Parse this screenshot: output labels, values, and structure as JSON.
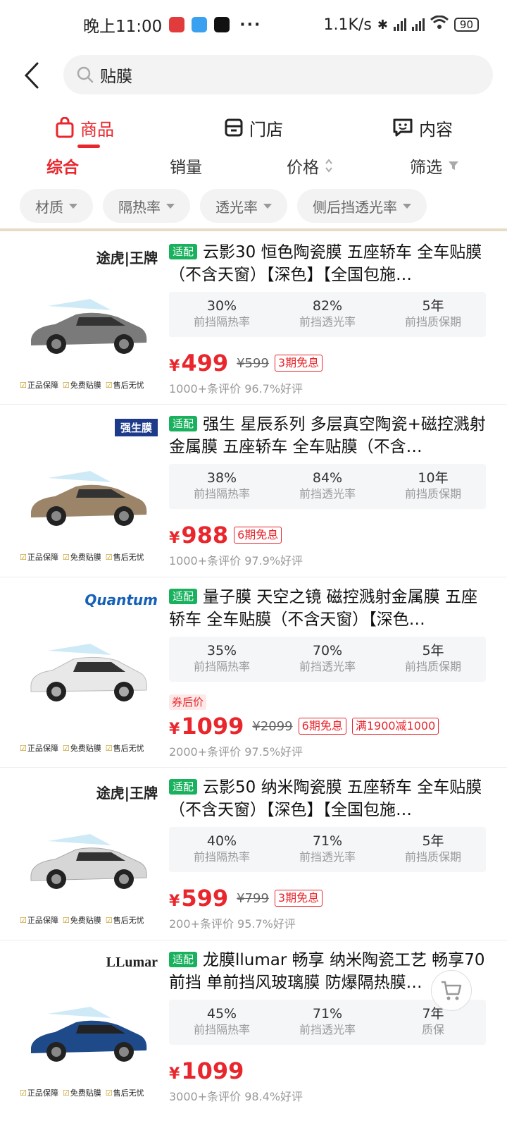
{
  "status": {
    "time": "晚上11:00",
    "net_speed": "1.1K/s",
    "battery": "90",
    "more": "···"
  },
  "search": {
    "query": "贴膜"
  },
  "tabs": [
    {
      "label": "商品"
    },
    {
      "label": "门店"
    },
    {
      "label": "内容"
    }
  ],
  "sort": {
    "comprehensive": "综合",
    "sales": "销量",
    "price": "价格",
    "filter": "筛选"
  },
  "filters": [
    "材质",
    "隔热率",
    "透光率",
    "侧后挡透光率"
  ],
  "common_badges": [
    "正品保障",
    "免费贴膜",
    "售后无忧"
  ],
  "fit_tag": "适配",
  "colors": {
    "accent": "#e8262c",
    "fit_green": "#19b15d"
  },
  "products": [
    {
      "brand": "途虎|王牌",
      "title": "云影30 恒色陶瓷膜 五座轿车 全车贴膜（不含天窗）【深色】【全国包施…",
      "specs": [
        {
          "v": "30%",
          "l": "前挡隔热率"
        },
        {
          "v": "82%",
          "l": "前挡透光率"
        },
        {
          "v": "5年",
          "l": "前挡质保期"
        }
      ],
      "coupon_note": "",
      "price": "499",
      "original_price": "¥599",
      "tags": [
        "3期免息"
      ],
      "reviews": "1000+条评价 96.7%好评"
    },
    {
      "brand": "强生膜",
      "title": "强生 星辰系列 多层真空陶瓷+磁控溅射金属膜 五座轿车 全车贴膜（不含…",
      "specs": [
        {
          "v": "38%",
          "l": "前挡隔热率"
        },
        {
          "v": "84%",
          "l": "前挡透光率"
        },
        {
          "v": "10年",
          "l": "前挡质保期"
        }
      ],
      "coupon_note": "",
      "price": "988",
      "original_price": "",
      "tags": [
        "6期免息"
      ],
      "reviews": "1000+条评价 97.9%好评"
    },
    {
      "brand": "Quantum",
      "title": "量子膜 天空之镜 磁控溅射金属膜 五座轿车 全车贴膜（不含天窗）【深色…",
      "specs": [
        {
          "v": "35%",
          "l": "前挡隔热率"
        },
        {
          "v": "70%",
          "l": "前挡透光率"
        },
        {
          "v": "5年",
          "l": "前挡质保期"
        }
      ],
      "coupon_note": "券后价",
      "price": "1099",
      "original_price": "¥2099",
      "tags": [
        "6期免息",
        "满1900减1000"
      ],
      "reviews": "2000+条评价 97.5%好评"
    },
    {
      "brand": "途虎|王牌",
      "title": "云影50 纳米陶瓷膜 五座轿车 全车贴膜（不含天窗）【深色】【全国包施…",
      "specs": [
        {
          "v": "40%",
          "l": "前挡隔热率"
        },
        {
          "v": "71%",
          "l": "前挡透光率"
        },
        {
          "v": "5年",
          "l": "前挡质保期"
        }
      ],
      "coupon_note": "",
      "price": "599",
      "original_price": "¥799",
      "tags": [
        "3期免息"
      ],
      "reviews": "200+条评价 95.7%好评"
    },
    {
      "brand": "LLumar",
      "title": "龙膜llumar 畅享 纳米陶瓷工艺 畅享70前挡 单前挡风玻璃膜 防爆隔热膜…",
      "specs": [
        {
          "v": "45%",
          "l": "前挡隔热率"
        },
        {
          "v": "71%",
          "l": "前挡透光率"
        },
        {
          "v": "7年",
          "l": "质保"
        }
      ],
      "coupon_note": "",
      "price": "1099",
      "original_price": "",
      "tags": [],
      "reviews": "3000+条评价 98.4%好评"
    }
  ]
}
